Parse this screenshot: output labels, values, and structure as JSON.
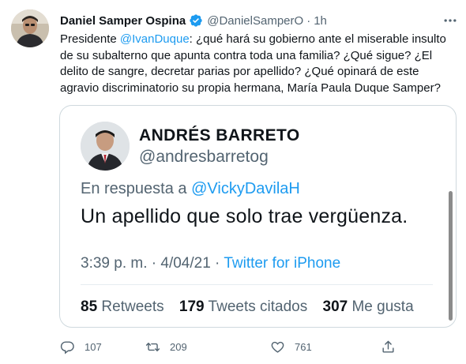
{
  "tweet": {
    "author_name": "Daniel Samper Ospina",
    "handle": "@DanielSamperO",
    "separator": "·",
    "time": "1h",
    "text_parts": {
      "p1": "Presidente ",
      "mention": "@IvanDuque",
      "p2": ": ¿qué hará su gobierno ante el miserable insulto de su subalterno que apunta contra toda una familia? ¿Qué sigue? ¿El delito de sangre, decretar parias por apellido? ¿Qué opinará de este agravio discriminatorio su propia hermana, María Paula Duque Samper?"
    }
  },
  "quoted_tweet": {
    "author_name": "ANDRÉS BARRETO",
    "handle": "@andresbarretog",
    "reply_prefix": "En respuesta a ",
    "reply_mention": "@VickyDavilaH",
    "text": "Un apellido que solo trae vergüenza.",
    "meta_time": "3:39 p. m. · 4/04/21 · ",
    "meta_source": "Twitter for iPhone",
    "retweets_count": "85",
    "retweets_label": "Retweets",
    "quotes_count": "179",
    "quotes_label": "Tweets citados",
    "likes_count": "307",
    "likes_label": "Me gusta"
  },
  "actions": {
    "reply_count": "107",
    "retweet_count": "209",
    "like_count": "761"
  },
  "colors": {
    "accent": "#1d9bf0",
    "muted": "#536471",
    "text": "#0f1419",
    "border": "#cfd9de"
  },
  "icons": [
    "verified-badge-icon",
    "more-icon",
    "reply-icon",
    "retweet-icon",
    "like-icon",
    "share-icon"
  ]
}
